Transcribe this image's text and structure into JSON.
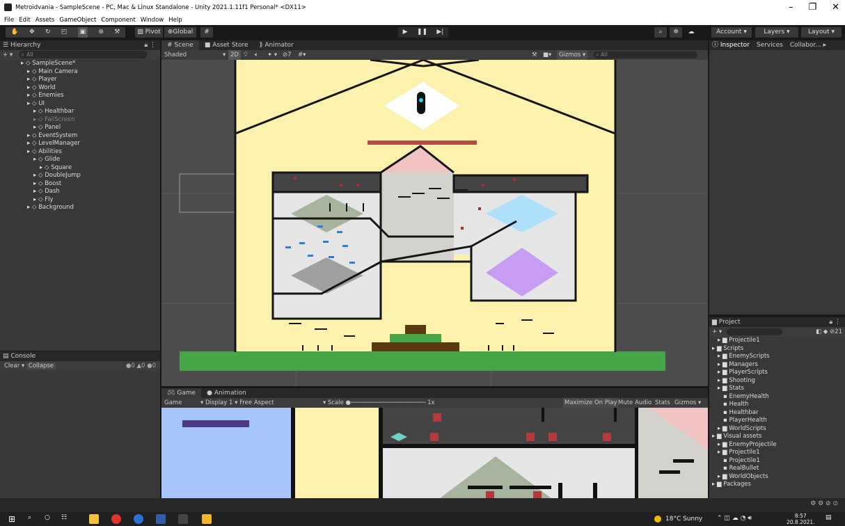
{
  "window": {
    "title": "Metroidvania - SampleScene - PC, Mac & Linux Standalone - Unity 2021.1.11f1 Personal* <DX11>"
  },
  "menu": [
    "File",
    "Edit",
    "Assets",
    "GameObject",
    "Component",
    "Window",
    "Help"
  ],
  "toolbar": {
    "pivot": "Pivot",
    "global": "Global",
    "account": "Account",
    "layers": "Layers",
    "layout": "Layout"
  },
  "hierarchy": {
    "title": "Hierarchy",
    "search_placeholder": "All",
    "items": [
      {
        "label": "SampleScene*",
        "depth": 0
      },
      {
        "label": "Main Camera",
        "depth": 1
      },
      {
        "label": "Player",
        "depth": 1
      },
      {
        "label": "World",
        "depth": 1
      },
      {
        "label": "Enemies",
        "depth": 1
      },
      {
        "label": "UI",
        "depth": 1
      },
      {
        "label": "Healthbar",
        "depth": 2
      },
      {
        "label": "FailScreen",
        "depth": 2,
        "dim": true
      },
      {
        "label": "Panel",
        "depth": 2
      },
      {
        "label": "EventSystem",
        "depth": 1
      },
      {
        "label": "LevelManager",
        "depth": 1
      },
      {
        "label": "Abilities",
        "depth": 1
      },
      {
        "label": "Glide",
        "depth": 2
      },
      {
        "label": "Square",
        "depth": 3
      },
      {
        "label": "DoubleJump",
        "depth": 2
      },
      {
        "label": "Boost",
        "depth": 2
      },
      {
        "label": "Dash",
        "depth": 2
      },
      {
        "label": "Fly",
        "depth": 2
      },
      {
        "label": "Background",
        "depth": 1
      }
    ]
  },
  "scene_tabs": [
    "Scene",
    "Asset Store",
    "Animator"
  ],
  "scene_toolbar": {
    "shading": "Shaded",
    "mode2d": "2D",
    "layers_count": "7",
    "gizmos": "Gizmos",
    "search": "All"
  },
  "right_tabs": [
    "Inspector",
    "Services",
    "Collabor..."
  ],
  "console": {
    "title": "Console",
    "clear": "Clear",
    "collapse": "Collapse",
    "counts": [
      "0",
      "0",
      "0"
    ]
  },
  "game_tabs": [
    "Game",
    "Animation"
  ],
  "game_toolbar": {
    "game": "Game",
    "display": "Display 1",
    "aspect": "Free Aspect",
    "scale": "Scale",
    "scale_value": "1x",
    "maximize": "Maximize On Play",
    "mute": "Mute Audio",
    "stats": "Stats",
    "gizmos": "Gizmos"
  },
  "project": {
    "title": "Project",
    "hidden_count": "21",
    "items": [
      {
        "label": "Projectile1",
        "depth": 1
      },
      {
        "label": "Scripts",
        "depth": 0
      },
      {
        "label": "EnemyScripts",
        "depth": 1
      },
      {
        "label": "Managers",
        "depth": 1
      },
      {
        "label": "PlayerScripts",
        "depth": 1
      },
      {
        "label": "Shooting",
        "depth": 1
      },
      {
        "label": "Stats",
        "depth": 1
      },
      {
        "label": "EnemyHealth",
        "depth": 2
      },
      {
        "label": "Health",
        "depth": 2
      },
      {
        "label": "Healthbar",
        "depth": 2
      },
      {
        "label": "PlayerHealth",
        "depth": 2
      },
      {
        "label": "WorldScripts",
        "depth": 1
      },
      {
        "label": "Visual assets",
        "depth": 0
      },
      {
        "label": "EnemyProjectile",
        "depth": 1
      },
      {
        "label": "Projectile1",
        "depth": 1
      },
      {
        "label": "Projectile1",
        "depth": 2
      },
      {
        "label": "RealBullet",
        "depth": 2
      },
      {
        "label": "WorldObjects",
        "depth": 1
      },
      {
        "label": "Packages",
        "depth": 0
      }
    ]
  },
  "taskbar": {
    "weather": "18°C Sunny",
    "time": "8:57",
    "date": "20.8.2021."
  }
}
